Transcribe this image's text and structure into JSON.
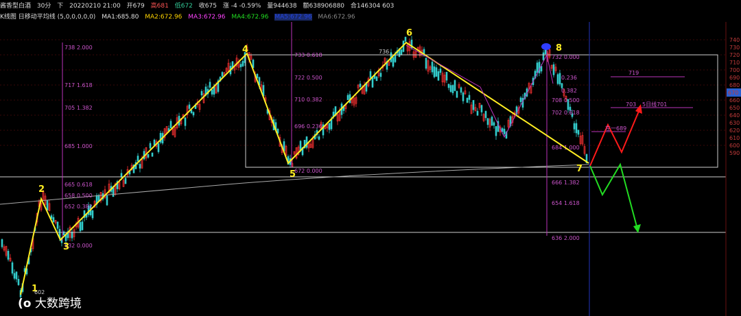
{
  "header": {
    "symbol": "酱香型白酒",
    "period": "30分",
    "direction": "下",
    "datetime": "20220210 21:00",
    "open": "开679",
    "high": "高681",
    "low": "低672",
    "close": "收675",
    "change": "涨 -4 -0.59%",
    "volume": "量944638",
    "amount": "额638906880",
    "oi": "合146304 603"
  },
  "indicator": {
    "name": "K线图 日移动平均线 (5,0,0,0,0,0)",
    "ma1": "MA1:685.80",
    "ma2": "MA2:672.96",
    "ma3": "MA3:672.96",
    "ma4": "MA4:672.96",
    "ma5": "MA5:672.96",
    "ma6": "MA6:672.96"
  },
  "colors": {
    "ma1": "#e0e0e0",
    "ma2": "#ffd400",
    "ma3": "#ff44ff",
    "ma4": "#22dd22",
    "ma5": "#2244dd",
    "ma6": "#888888",
    "wave": "#ffee22",
    "fib": "#bb33bb",
    "up_candle": "#ff3333",
    "down_candle": "#33cccc",
    "forecast_red": "#ff1a1a",
    "forecast_green": "#22dd22"
  },
  "price_axis": {
    "labels": [
      "740",
      "730",
      "720",
      "710",
      "700",
      "690",
      "680",
      "670",
      "660",
      "650",
      "640",
      "630",
      "620",
      "610",
      "600",
      "590"
    ],
    "current_price": "670"
  },
  "waves": [
    "1",
    "2",
    "3",
    "4",
    "5",
    "6",
    "7",
    "8"
  ],
  "fib_left": [
    "738 2.000",
    "717 1.618",
    "705 1.382",
    "685 1.000",
    "665 0.618",
    "658 0.500",
    "652 0.382",
    "632 0.000"
  ],
  "fib_mid": [
    "733 0.618",
    "722 0.500",
    "710 0.382",
    "696 0.236",
    "672 0.000"
  ],
  "fib_right": [
    "732 0.000",
    "0.236",
    "0.382",
    "708 0.500",
    "702 0.618",
    "684 1.000",
    "666 1.382",
    "654 1.618",
    "636 2.000"
  ],
  "annotations": {
    "peak": "736",
    "low1": "602",
    "target_719": "719",
    "target_703": "703",
    "ma5_label": "5日线701",
    "target_689": "左一689"
  },
  "watermark": "大数跨境"
}
